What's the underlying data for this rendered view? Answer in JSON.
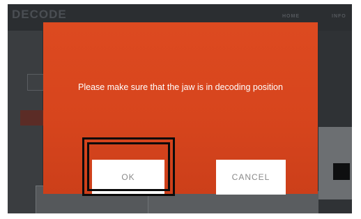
{
  "app": {
    "brand": "DECODE",
    "brand_subtitle": "",
    "nav": {
      "home": "HOME",
      "info": "INFO"
    }
  },
  "dialog": {
    "message": "Please make sure that the jaw is in decoding position",
    "ok_label": "OK",
    "cancel_label": "CANCEL",
    "background_color": "#d7451d"
  },
  "highlight": {
    "target": "ok-button",
    "color": "#0b0b0b"
  }
}
